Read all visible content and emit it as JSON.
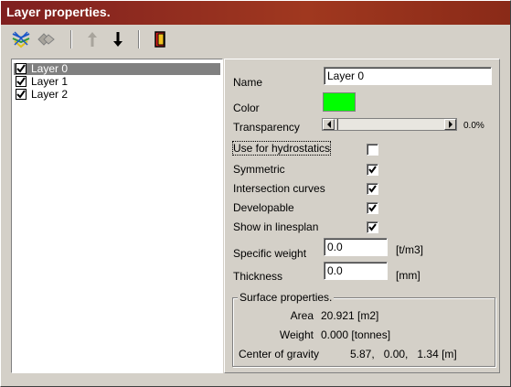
{
  "window": {
    "title": "Layer properties."
  },
  "toolbar": {
    "buttons": [
      {
        "icon": "layer-add-icon"
      },
      {
        "icon": "layer-delete-icon"
      },
      {
        "icon": "move-up-icon"
      },
      {
        "icon": "move-down-icon"
      },
      {
        "icon": "exit-icon"
      }
    ]
  },
  "layers": [
    {
      "label": "Layer 0",
      "checked": true,
      "selected": true
    },
    {
      "label": "Layer 1",
      "checked": true,
      "selected": false
    },
    {
      "label": "Layer 2",
      "checked": true,
      "selected": false
    }
  ],
  "props": {
    "name_label": "Name",
    "name_value": "Layer 0",
    "color_label": "Color",
    "color_value": "#00ff00",
    "transparency_label": "Transparency",
    "transparency_value": "0.0%",
    "transparency_fraction": 0.0,
    "hydrostatics_label": "Use for hydrostatics",
    "hydrostatics_checked": false,
    "symmetric_label": "Symmetric",
    "symmetric_checked": true,
    "intersection_label": "Intersection curves",
    "intersection_checked": true,
    "developable_label": "Developable",
    "developable_checked": true,
    "linesplan_label": "Show in linesplan",
    "linesplan_checked": true,
    "weight_label": "Specific weight",
    "weight_value": "0.0",
    "weight_unit": "[t/m3]",
    "thickness_label": "Thickness",
    "thickness_value": "0.0",
    "thickness_unit": "[mm]"
  },
  "surface": {
    "legend": "Surface properties.",
    "area_label": "Area",
    "area_value": "20.921 [m2]",
    "weight_label": "Weight",
    "weight_value": "0.000 [tonnes]",
    "cog_label": "Center of gravity",
    "cog_value": "5.87,   0.00,   1.34 [m]"
  }
}
